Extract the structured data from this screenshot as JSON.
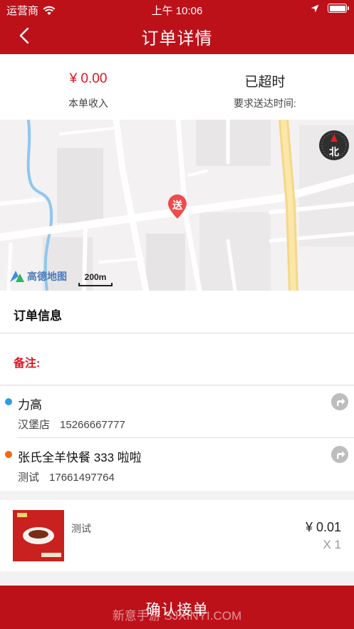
{
  "status_bar": {
    "carrier": "运营商",
    "time": "上午 10:06",
    "icons": [
      "wifi-icon",
      "location-arrow-icon",
      "battery-icon"
    ]
  },
  "nav": {
    "back_icon": "chevron-left-icon",
    "title": "订单详情"
  },
  "summary": {
    "income_value": "¥ 0.00",
    "income_label": "本单收入",
    "delivery_value": "已超时",
    "delivery_label": "要求送达时间:"
  },
  "map": {
    "pin_label": "送",
    "compass_label": "北",
    "logo_text": "高德地图",
    "scale_text": "200m"
  },
  "order_info": {
    "title": "订单信息"
  },
  "remark": {
    "label": "备注:"
  },
  "contacts": [
    {
      "name": "力高",
      "subtitle": "汉堡店",
      "phone": "15266667777",
      "dot_color": "#2d9ce8",
      "nav_icon": "navigate-arrow-icon"
    },
    {
      "name": "张氏全羊快餐 333 啦啦",
      "subtitle": "测试",
      "phone": "17661497764",
      "dot_color": "#f06a12",
      "nav_icon": "navigate-arrow-icon"
    }
  ],
  "goods": {
    "name": "测试",
    "price": "¥ 0.01",
    "quantity": "X 1"
  },
  "confirm_button": "确认接单",
  "watermark": "新意手游 SJXINYI.COM",
  "colors": {
    "brand": "#bd111a",
    "accent_red": "#e0141e"
  }
}
